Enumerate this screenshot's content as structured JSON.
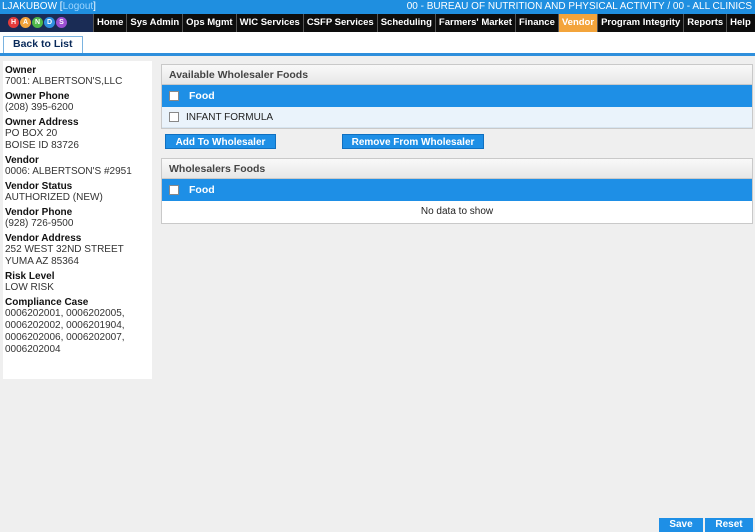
{
  "header": {
    "user": "LJAKUBOW",
    "logout": "Logout",
    "org": "00 - BUREAU OF NUTRITION AND PHYSICAL ACTIVITY / 00 - ALL CLINICS"
  },
  "logo": {
    "letters": [
      "H",
      "A",
      "N",
      "D",
      "S"
    ],
    "colors": [
      "#e23b3b",
      "#f2a33b",
      "#4fb84a",
      "#2f8fe0",
      "#9b4fd1"
    ]
  },
  "nav": [
    {
      "label": "Home",
      "active": false
    },
    {
      "label": "Sys Admin",
      "active": false
    },
    {
      "label": "Ops Mgmt",
      "active": false
    },
    {
      "label": "WIC Services",
      "active": false
    },
    {
      "label": "CSFP Services",
      "active": false
    },
    {
      "label": "Scheduling",
      "active": false
    },
    {
      "label": "Farmers' Market",
      "active": false
    },
    {
      "label": "Finance",
      "active": false
    },
    {
      "label": "Vendor",
      "active": true
    },
    {
      "label": "Program Integrity",
      "active": false
    },
    {
      "label": "Reports",
      "active": false
    },
    {
      "label": "Help",
      "active": false
    }
  ],
  "toolbar": {
    "back_label": "Back to List"
  },
  "vendor_info": {
    "owner_label": "Owner",
    "owner": "7001: ALBERTSON'S,LLC",
    "owner_phone_label": "Owner Phone",
    "owner_phone": "(208) 395-6200",
    "owner_address_label": "Owner Address",
    "owner_address_1": "PO BOX 20",
    "owner_address_2": "BOISE ID 83726",
    "vendor_label": "Vendor",
    "vendor": "0006: ALBERTSON'S #2951",
    "vendor_status_label": "Vendor Status",
    "vendor_status": "AUTHORIZED (NEW)",
    "vendor_phone_label": "Vendor Phone",
    "vendor_phone": "(928) 726-9500",
    "vendor_address_label": "Vendor Address",
    "vendor_address_1": "252 WEST 32ND STREET",
    "vendor_address_2": "YUMA AZ 85364",
    "risk_label": "Risk Level",
    "risk": "LOW RISK",
    "compliance_label": "Compliance Case",
    "compliance_1": "0006202001, 0006202005,",
    "compliance_2": "0006202002, 0006201904,",
    "compliance_3": "0006202006, 0006202007,",
    "compliance_4": "0006202004"
  },
  "available": {
    "title": "Available Wholesaler Foods",
    "column": "Food",
    "rows": [
      "INFANT FORMULA"
    ]
  },
  "actions": {
    "add": "Add To Wholesaler",
    "remove": "Remove From Wholesaler"
  },
  "wholesalers": {
    "title": "Wholesalers Foods",
    "column": "Food",
    "empty": "No data to show"
  },
  "footer": {
    "save": "Save",
    "reset": "Reset"
  }
}
